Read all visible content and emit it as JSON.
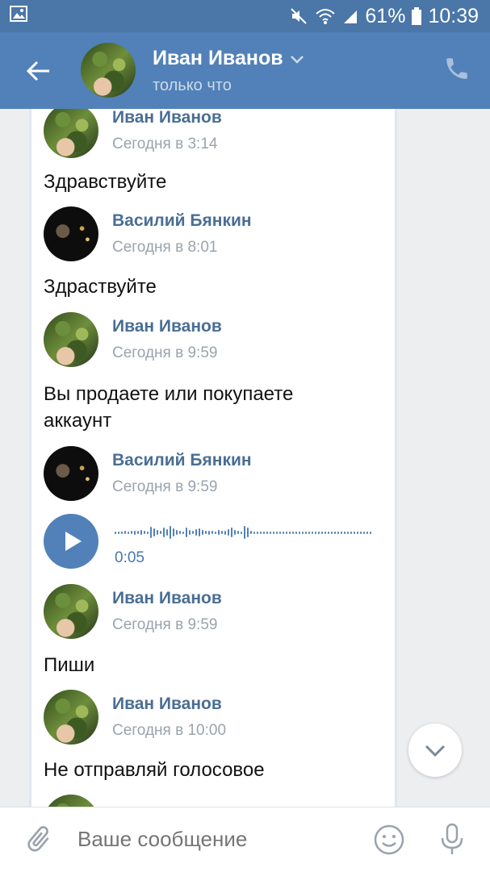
{
  "status_bar": {
    "battery": "61%",
    "time": "10:39",
    "icons": [
      "gallery-icon",
      "mute-icon",
      "wifi-icon",
      "signal-icon",
      "battery-icon"
    ]
  },
  "header": {
    "title": "Иван Иванов",
    "subtitle": "только что",
    "icons": [
      "back-arrow-icon",
      "chevron-down-icon",
      "phone-icon"
    ]
  },
  "messages": [
    {
      "author": "Иван Иванов",
      "time": "Сегодня в 3:14",
      "text": "Здравствуйте"
    },
    {
      "author": "Василий Бянкин",
      "time": "Сегодня в 8:01",
      "text": "Здраствуйте"
    },
    {
      "author": "Иван Иванов",
      "time": "Сегодня в 9:59",
      "text": "Вы продаете или покупаете аккаунт"
    },
    {
      "author": "Василий Бянкин",
      "time": "Сегодня в 9:59",
      "voice_duration": "0:05"
    },
    {
      "author": "Иван Иванов",
      "time": "Сегодня в 9:59",
      "text": "Пиши"
    },
    {
      "author": "Иван Иванов",
      "time": "Сегодня в 10:00",
      "text": "Не отправляй голосовое"
    }
  ],
  "input": {
    "placeholder": "Ваше сообщение",
    "icons": [
      "attach-icon",
      "emoji-icon",
      "microphone-icon"
    ]
  },
  "colors": {
    "status_bar": "#4a76a8",
    "header": "#5181b8",
    "accent": "#5181b8",
    "author_name": "#4a6e94"
  }
}
